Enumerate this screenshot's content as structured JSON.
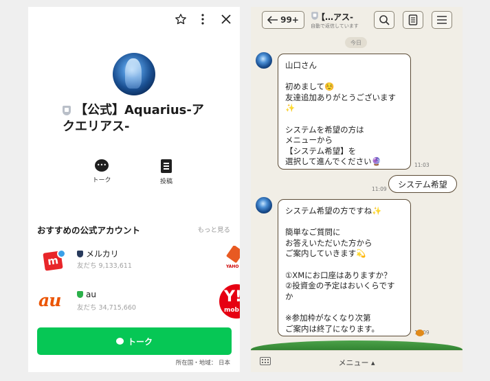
{
  "left_panel": {
    "profile_name": "【公式】Aquarius-アクエリアス-",
    "actions": [
      {
        "label": "トーク"
      },
      {
        "label": "投稿"
      }
    ],
    "recommended_title": "おすすめの公式アカウント",
    "more_label": "もっと見る",
    "accounts": [
      {
        "name": "メルカリ",
        "friends": "友だち 9,133,611",
        "logo_text": "m",
        "shield_color": "#283a5c"
      },
      {
        "name": "au",
        "friends": "友だち 34,715,660",
        "logo_text": "au",
        "shield_color": "#2bb04a"
      }
    ],
    "peek_logos": [
      "YAHO",
      "Y!",
      "mob"
    ],
    "talk_button_label": "トーク",
    "country_label": "所在国・地域： 日本"
  },
  "right_panel": {
    "back_count": "99+",
    "chat_title": "【…アス-",
    "chat_subtitle": "自動で返信しています",
    "date_chip": "今日",
    "messages": [
      {
        "dir": "in",
        "text": "山口さん\n\n初めまして☺️\n友達追加ありがとうございます\n✨\n\nシステムを希望の方は\nメニューから\n【システム希望】を\n選択して進んでください🔮",
        "time": "11:03"
      },
      {
        "dir": "out",
        "text": "システム希望",
        "time": "11:09"
      },
      {
        "dir": "in",
        "text": "システム希望の方ですね✨\n\n簡単なご質問に\nお答えいただいた方から\nご案内していきます💫\n\n①XMにお口座はありますか？\n②投資金の予定はおいくらです\nか\n\n※参加枠がなくなり次第\nご案内は終了になります。",
        "time": "11:09"
      }
    ],
    "menu_label": "メニュー ▴"
  },
  "colors": {
    "line_green": "#06c755",
    "bubble_border": "#5a4a35",
    "chat_bg": "#f1eee6",
    "mercari_red": "#e8262a",
    "au_orange": "#eb5505",
    "ymobile_red": "#e60012"
  }
}
